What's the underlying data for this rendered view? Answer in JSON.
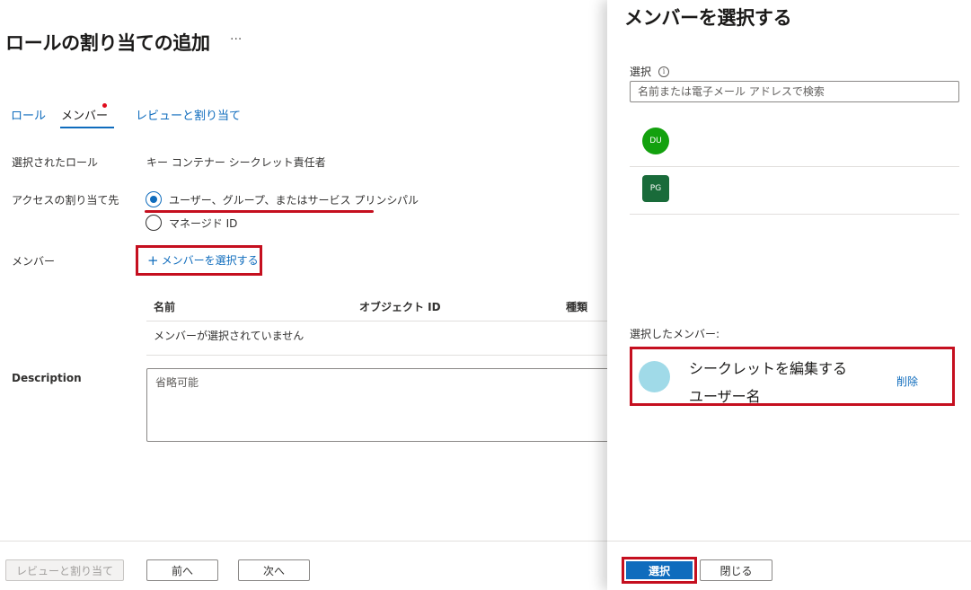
{
  "header": {
    "title": "ロールの割り当ての追加",
    "more": "···"
  },
  "tabs": [
    {
      "label": "ロール"
    },
    {
      "label": "メンバー"
    },
    {
      "label": "レビューと割り当て"
    }
  ],
  "form": {
    "role_label": "選択されたロール",
    "role_value": "キー コンテナー シークレット責任者",
    "access_label": "アクセスの割り当て先",
    "options": [
      {
        "label": "ユーザー、グループ、またはサービス プリンシパル",
        "checked": true
      },
      {
        "label": "マネージド ID",
        "checked": false
      }
    ],
    "members_label": "メンバー",
    "select_members_link": "メンバーを選択する",
    "select_members_icon": "plus-icon",
    "table": {
      "columns": [
        "名前",
        "オブジェクト ID",
        "種類"
      ],
      "empty_text": "メンバーが選択されていません"
    },
    "description_label": "Description",
    "description_placeholder": "省略可能"
  },
  "footer": {
    "review_button": "レビューと割り当て",
    "prev_button": "前へ",
    "next_button": "次へ"
  },
  "panel": {
    "title": "メンバーを選択する",
    "select_label": "選択",
    "info_icon": "i",
    "search_placeholder": "名前または電子メール アドレスで検索",
    "results": [
      {
        "initials": "DU",
        "color": "#13a10e",
        "shape": "round"
      },
      {
        "initials": "PG",
        "color": "#196b3a",
        "shape": "square"
      }
    ],
    "selected_label": "選択したメンバー:",
    "selected_member": {
      "name": "シークレットを編集する",
      "subtitle": "ユーザー名",
      "avatar_color": "#a0dae8",
      "remove_label": "削除"
    },
    "select_button": "選択",
    "close_button": "閉じる"
  },
  "colors": {
    "accent": "#0f6cbd",
    "highlight": "#c50f1f",
    "required_dot": "#e00b1c"
  }
}
